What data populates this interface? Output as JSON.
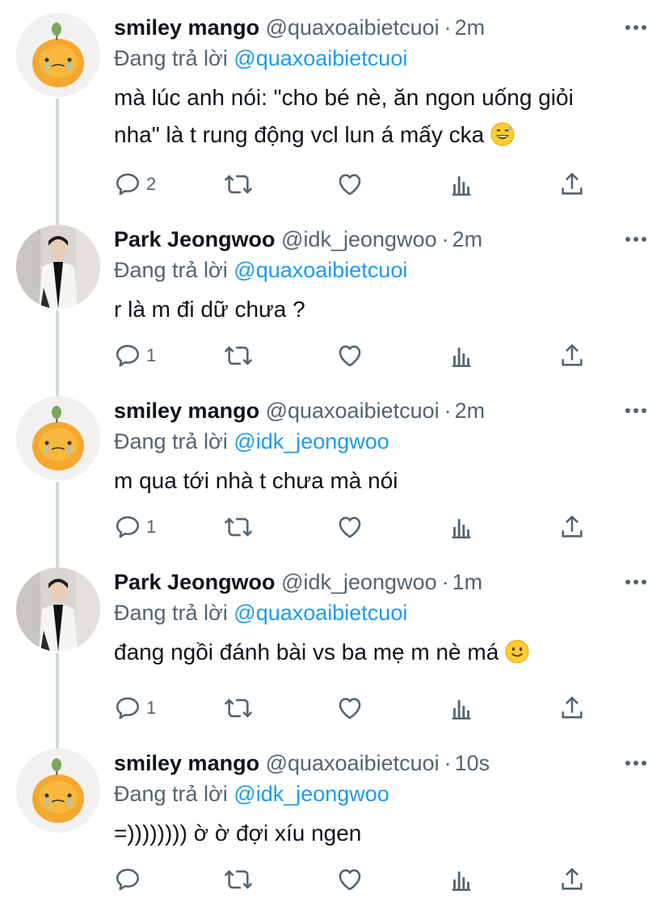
{
  "tweets": [
    {
      "display_name": "smiley mango",
      "handle": "@quaxoaibietcuoi",
      "separator": "·",
      "time": "2m",
      "reply_prefix": "Đang trả lời",
      "reply_to": "@quaxoaibietcuoi",
      "text_line1": "mà lúc anh nói: \"cho bé nè, ăn ngon uống giỏi",
      "text_line2": "nha\" là t rung động vcl lun á mấy cka",
      "emoji": "grinning-sweat-emoji",
      "replies": "2",
      "avatar": "mango-avatar"
    },
    {
      "display_name": "Park Jeongwoo",
      "handle": "@idk_jeongwoo",
      "separator": "·",
      "time": "2m",
      "reply_prefix": "Đang trả lời",
      "reply_to": "@quaxoaibietcuoi",
      "text_line1": "r là m đi dữ chưa ?",
      "replies": "1",
      "avatar": "person-photo-avatar"
    },
    {
      "display_name": "smiley mango",
      "handle": "@quaxoaibietcuoi",
      "separator": "·",
      "time": "2m",
      "reply_prefix": "Đang trả lời",
      "reply_to": "@idk_jeongwoo",
      "text_line1": "m qua tới nhà t chưa mà nói",
      "replies": "1",
      "avatar": "mango-avatar"
    },
    {
      "display_name": "Park Jeongwoo",
      "handle": "@idk_jeongwoo",
      "separator": "·",
      "time": "1m",
      "reply_prefix": "Đang trả lời",
      "reply_to": "@quaxoaibietcuoi",
      "text_line1": "đang ngồi đánh bài vs ba mẹ m nè má",
      "emoji": "slightly-smiling-emoji",
      "replies": "1",
      "avatar": "person-photo-avatar"
    },
    {
      "display_name": "smiley mango",
      "handle": "@quaxoaibietcuoi",
      "separator": "·",
      "time": "10s",
      "reply_prefix": "Đang trả lời",
      "reply_to": "@idk_jeongwoo",
      "text_line1": "=)))))))) ờ ờ đợi xíu ngen",
      "replies": "",
      "avatar": "mango-avatar"
    }
  ],
  "colors": {
    "text": "#0f1419",
    "secondary": "#536471",
    "link": "#1d9bf0",
    "thread_line": "#cfd9de"
  },
  "icons": [
    "reply-icon",
    "retweet-icon",
    "like-icon",
    "analytics-icon",
    "share-icon",
    "more-icon"
  ]
}
